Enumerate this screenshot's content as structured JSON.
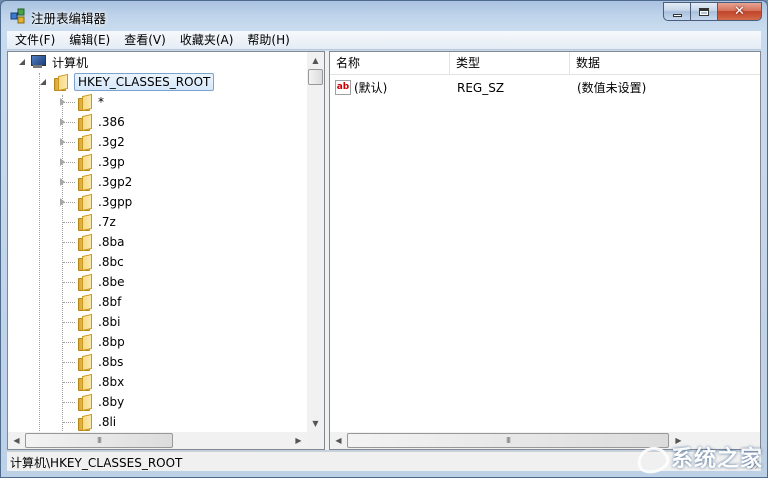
{
  "window": {
    "title": "注册表编辑器"
  },
  "menu": [
    "文件(F)",
    "编辑(E)",
    "查看(V)",
    "收藏夹(A)",
    "帮助(H)"
  ],
  "tree": {
    "root": "计算机",
    "selected": "HKEY_CLASSES_ROOT",
    "children": [
      {
        "label": "*",
        "expandable": true
      },
      {
        "label": ".386",
        "expandable": true
      },
      {
        "label": ".3g2",
        "expandable": true
      },
      {
        "label": ".3gp",
        "expandable": true
      },
      {
        "label": ".3gp2",
        "expandable": true
      },
      {
        "label": ".3gpp",
        "expandable": true
      },
      {
        "label": ".7z",
        "expandable": false
      },
      {
        "label": ".8ba",
        "expandable": false
      },
      {
        "label": ".8bc",
        "expandable": false
      },
      {
        "label": ".8be",
        "expandable": false
      },
      {
        "label": ".8bf",
        "expandable": false
      },
      {
        "label": ".8bi",
        "expandable": false
      },
      {
        "label": ".8bp",
        "expandable": false
      },
      {
        "label": ".8bs",
        "expandable": false
      },
      {
        "label": ".8bx",
        "expandable": false
      },
      {
        "label": ".8by",
        "expandable": false
      },
      {
        "label": ".8li",
        "expandable": false
      }
    ]
  },
  "list": {
    "columns": [
      "名称",
      "类型",
      "数据"
    ],
    "rows": [
      {
        "icon": "ab",
        "name": "(默认)",
        "type": "REG_SZ",
        "data": "(数值未设置)"
      }
    ]
  },
  "scroll": {
    "grip": "III"
  },
  "status": {
    "path": "计算机\\HKEY_CLASSES_ROOT"
  },
  "watermark": {
    "text": "系统之家"
  },
  "colors": {
    "titlebar": "#bed3ea",
    "selection": "#d6e8fb",
    "close_button": "#c2432a"
  }
}
